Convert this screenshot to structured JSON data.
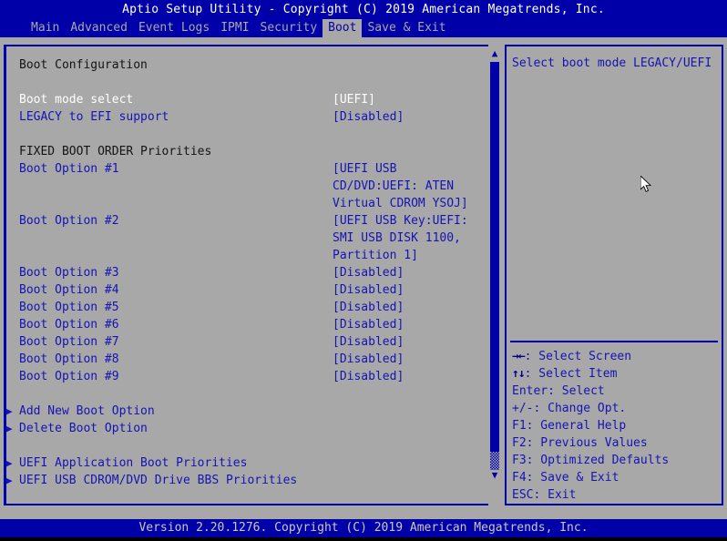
{
  "window": {
    "title": "Aptio Setup Utility - Copyright (C) 2019 American Megatrends, Inc.",
    "footer": "Version 2.20.1276. Copyright (C) 2019 American Megatrends, Inc."
  },
  "colors": {
    "header_bg": "#0000A8",
    "panel_bg": "#A8A8A8",
    "item_text": "#1414B4",
    "heading_text": "#141414",
    "selected_text": "#FFFFFF",
    "active_tab_bg": "#A8A8A8",
    "active_tab_text": "#0000A8"
  },
  "menu": {
    "items": [
      {
        "label": "Main",
        "active": false
      },
      {
        "label": "Advanced",
        "active": false
      },
      {
        "label": "Event Logs",
        "active": false
      },
      {
        "label": "IPMI",
        "active": false
      },
      {
        "label": "Security",
        "active": false
      },
      {
        "label": "Boot",
        "active": true
      },
      {
        "label": "Save & Exit",
        "active": false
      }
    ]
  },
  "main": {
    "section_title": "Boot Configuration",
    "rows": [
      {
        "kind": "spacer"
      },
      {
        "kind": "option",
        "label": "Boot mode select",
        "value": "[UEFI]",
        "selected": true
      },
      {
        "kind": "option",
        "label": "LEGACY to EFI support",
        "value": "[Disabled]",
        "selected": false
      },
      {
        "kind": "spacer"
      },
      {
        "kind": "heading",
        "label": "FIXED BOOT ORDER Priorities"
      },
      {
        "kind": "option",
        "label": "Boot Option #1",
        "value": "[UEFI USB",
        "selected": false
      },
      {
        "kind": "valuecont",
        "value": "CD/DVD:UEFI: ATEN"
      },
      {
        "kind": "valuecont",
        "value": "Virtual CDROM YSOJ]"
      },
      {
        "kind": "option",
        "label": "Boot Option #2",
        "value": "[UEFI USB Key:UEFI:",
        "selected": false
      },
      {
        "kind": "valuecont",
        "value": "SMI USB DISK 1100,"
      },
      {
        "kind": "valuecont",
        "value": "Partition 1]"
      },
      {
        "kind": "option",
        "label": "Boot Option #3",
        "value": "[Disabled]",
        "selected": false
      },
      {
        "kind": "option",
        "label": "Boot Option #4",
        "value": "[Disabled]",
        "selected": false
      },
      {
        "kind": "option",
        "label": "Boot Option #5",
        "value": "[Disabled]",
        "selected": false
      },
      {
        "kind": "option",
        "label": "Boot Option #6",
        "value": "[Disabled]",
        "selected": false
      },
      {
        "kind": "option",
        "label": "Boot Option #7",
        "value": "[Disabled]",
        "selected": false
      },
      {
        "kind": "option",
        "label": "Boot Option #8",
        "value": "[Disabled]",
        "selected": false
      },
      {
        "kind": "option",
        "label": "Boot Option #9",
        "value": "[Disabled]",
        "selected": false
      },
      {
        "kind": "spacer"
      },
      {
        "kind": "submenu",
        "label": "Add New Boot Option"
      },
      {
        "kind": "submenu",
        "label": "Delete Boot Option"
      },
      {
        "kind": "spacer"
      },
      {
        "kind": "submenu",
        "label": "UEFI Application Boot Priorities"
      },
      {
        "kind": "submenu",
        "label": "UEFI USB CDROM/DVD Drive BBS Priorities"
      }
    ]
  },
  "scrollbar": {
    "up_glyph": "▲",
    "down_glyph": "▼"
  },
  "help": {
    "text": "Select boot mode LEGACY/UEFI"
  },
  "keys": [
    {
      "glyph": "→←",
      "text": ": Select Screen"
    },
    {
      "glyph": "↑↓",
      "text": ": Select Item"
    },
    {
      "glyph": "",
      "text": "Enter: Select"
    },
    {
      "glyph": "",
      "text": "+/-: Change Opt."
    },
    {
      "glyph": "",
      "text": "F1: General Help"
    },
    {
      "glyph": "",
      "text": "F2: Previous Values"
    },
    {
      "glyph": "",
      "text": "F3: Optimized Defaults"
    },
    {
      "glyph": "",
      "text": "F4: Save & Exit"
    },
    {
      "glyph": "",
      "text": "ESC: Exit"
    }
  ]
}
